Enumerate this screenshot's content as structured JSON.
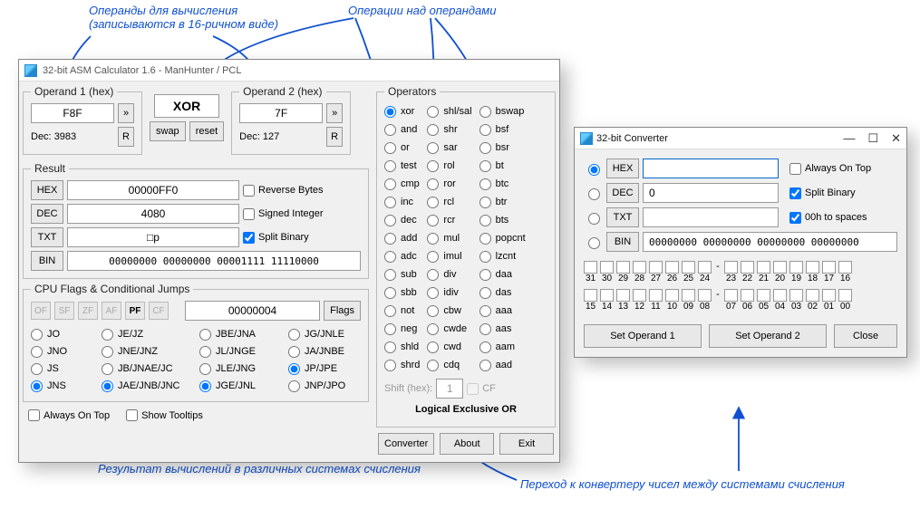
{
  "annot": {
    "operands": "Операнды для вычисления",
    "operands2": "(записываются в 16-ричном виде)",
    "operations": "Операции над операндами",
    "results": "Результат вычислений в различных системах счисления",
    "converter": "Переход к конвертеру чисел между системами счисления"
  },
  "main": {
    "title": "32-bit ASM Calculator 1.6 - ManHunter / PCL",
    "operand1": {
      "legend": "Operand 1 (hex)",
      "value": "F8F",
      "decLabel": "Dec:",
      "decValue": "3983",
      "moveBtn": "»",
      "rBtn": "R"
    },
    "mid": {
      "op": "XOR",
      "swap": "swap",
      "reset": "reset"
    },
    "operand2": {
      "legend": "Operand 2 (hex)",
      "value": "7F",
      "decLabel": "Dec:",
      "decValue": "127",
      "moveBtn": "»",
      "rBtn": "R"
    },
    "result": {
      "legend": "Result",
      "hexBtn": "HEX",
      "hex": "00000FF0",
      "decBtn": "DEC",
      "dec": "4080",
      "txtBtn": "TXT",
      "txt": "□p",
      "binBtn": "BIN",
      "bin": "00000000 00000000 00001111 11110000",
      "reverseBytes": "Reverse Bytes",
      "signedInt": "Signed Integer",
      "splitBinary": "Split Binary"
    },
    "flags": {
      "legend": "CPU Flags & Conditional Jumps",
      "names": [
        "OF",
        "SF",
        "ZF",
        "AF",
        "PF",
        "CF"
      ],
      "active": "PF",
      "count": "00000004",
      "flagsBtn": "Flags"
    },
    "jumps": {
      "col1": [
        "JO",
        "JNO",
        "JS",
        "JNS"
      ],
      "col2": [
        "JE/JZ",
        "JNE/JNZ",
        "JB/JNAE/JC",
        "JAE/JNB/JNC"
      ],
      "col3": [
        "JBE/JNA",
        "JL/JNGE",
        "JLE/JNG",
        "JGE/JNL"
      ],
      "col4": [
        "JG/JNLE",
        "JA/JNBE",
        "JP/JPE",
        "JNP/JPO"
      ],
      "sel": [
        "JNO",
        "JNE/JNZ",
        "JNS",
        "JAE/JNB/JNC",
        "JGE/JNL",
        "JG/JNLE",
        "JA/JNBE",
        "JP/JPE"
      ]
    },
    "opts": {
      "alwaysOnTop": "Always On Top",
      "showTooltips": "Show Tooltips"
    },
    "bottom": {
      "converter": "Converter",
      "about": "About",
      "exit": "Exit"
    },
    "operators": {
      "legend": "Operators",
      "col1": [
        "xor",
        "and",
        "or",
        "test",
        "cmp",
        "inc",
        "dec",
        "add",
        "adc",
        "sub",
        "sbb",
        "not",
        "neg",
        "shld",
        "shrd"
      ],
      "col2": [
        "shl/sal",
        "shr",
        "sar",
        "rol",
        "ror",
        "rcl",
        "rcr",
        "mul",
        "imul",
        "div",
        "idiv",
        "cbw",
        "cwde",
        "cwd",
        "cdq"
      ],
      "col3": [
        "bswap",
        "bsf",
        "bsr",
        "bt",
        "btc",
        "btr",
        "bts",
        "popcnt",
        "lzcnt",
        "daa",
        "das",
        "aaa",
        "aas",
        "aam",
        "aad"
      ],
      "selected": "xor",
      "shiftLabel": "Shift (hex):",
      "shiftVal": "1",
      "cf": "CF",
      "desc": "Logical Exclusive OR"
    }
  },
  "conv": {
    "title": "32-bit Converter",
    "rows": {
      "hex": {
        "btn": "HEX",
        "val": ""
      },
      "dec": {
        "btn": "DEC",
        "val": "0"
      },
      "txt": {
        "btn": "TXT",
        "val": ""
      },
      "bin": {
        "btn": "BIN",
        "val": "00000000 00000000 00000000 00000000"
      }
    },
    "opts": {
      "alwaysOnTop": "Always On Top",
      "splitBinary": "Split Binary",
      "zeroSpaces": "00h to spaces"
    },
    "bits": {
      "hi": [
        "31",
        "30",
        "29",
        "28",
        "27",
        "26",
        "25",
        "24",
        "23",
        "22",
        "21",
        "20",
        "19",
        "18",
        "17",
        "16"
      ],
      "lo": [
        "15",
        "14",
        "13",
        "12",
        "11",
        "10",
        "09",
        "08",
        "07",
        "06",
        "05",
        "04",
        "03",
        "02",
        "01",
        "00"
      ]
    },
    "buttons": {
      "set1": "Set Operand 1",
      "set2": "Set Operand 2",
      "close": "Close"
    }
  }
}
